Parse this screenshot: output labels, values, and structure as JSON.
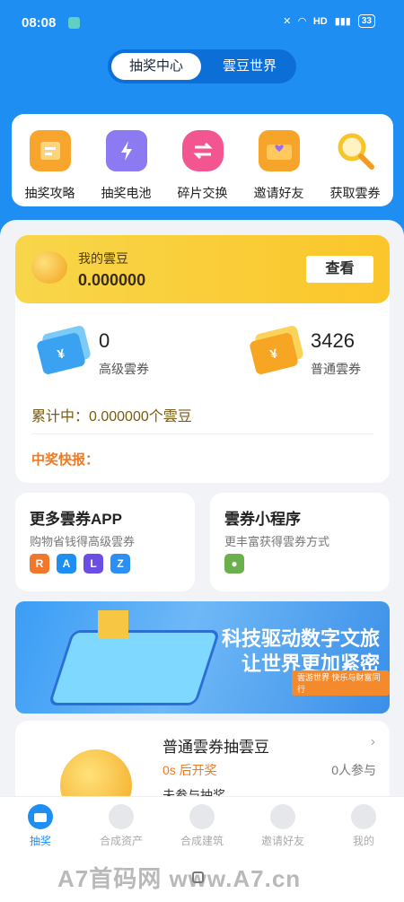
{
  "status_bar": {
    "time": "08:08",
    "battery": "33"
  },
  "segment": {
    "active": "抽奖中心",
    "inactive": "雲豆世界"
  },
  "menu": [
    {
      "label": "抽奖攻略",
      "icon": "guide-icon",
      "color": "#f7a52c"
    },
    {
      "label": "抽奖电池",
      "icon": "battery-icon",
      "color": "#8b7af2"
    },
    {
      "label": "碎片交换",
      "icon": "exchange-icon",
      "color": "#f2558f"
    },
    {
      "label": "邀请好友",
      "icon": "envelope-icon",
      "color": "#f6a42a"
    },
    {
      "label": "获取雲券",
      "icon": "magnifier-icon",
      "color": "#f7c52a"
    }
  ],
  "cloud_beans": {
    "title": "我的雲豆",
    "value": "0.000000",
    "view_button": "查看"
  },
  "tickets": {
    "senior": {
      "count": "0",
      "label": "高级雲券",
      "symbol": "¥"
    },
    "normal": {
      "count": "3426",
      "label": "普通雲券",
      "symbol": "¥"
    }
  },
  "accumulated": "累计中：0.000000个雲豆",
  "flash_news": "中奖快报：",
  "more_apps": {
    "title": "更多雲券APP",
    "subtitle": "购物省钱得高级雲券",
    "apps": [
      "R",
      "A",
      "L",
      "Z"
    ]
  },
  "mini_program": {
    "title": "雲券小程序",
    "subtitle": "更丰富获得雲券方式"
  },
  "banner": {
    "line1": "科技驱动数字文旅",
    "line2": "让世界更加紧密",
    "tag": "雲游世界 快乐与财富同行"
  },
  "lottery": {
    "title": "普通雲券抽雲豆",
    "countdown": "0s 后开奖",
    "participants": "0人参与",
    "status": "未参与抽奖"
  },
  "tabbar": [
    {
      "label": "抽奖",
      "icon": "lottery-tab-icon"
    },
    {
      "label": "合成资产",
      "icon": "asset-tab-icon"
    },
    {
      "label": "合成建筑",
      "icon": "building-tab-icon"
    },
    {
      "label": "邀请好友",
      "icon": "invite-tab-icon"
    },
    {
      "label": "我的",
      "icon": "profile-tab-icon"
    }
  ],
  "watermark": "A7首码网 www.A7.cn",
  "colors": {
    "primary": "#1e8ef3",
    "gold": "#fbc62a",
    "orange": "#ef7a22"
  }
}
